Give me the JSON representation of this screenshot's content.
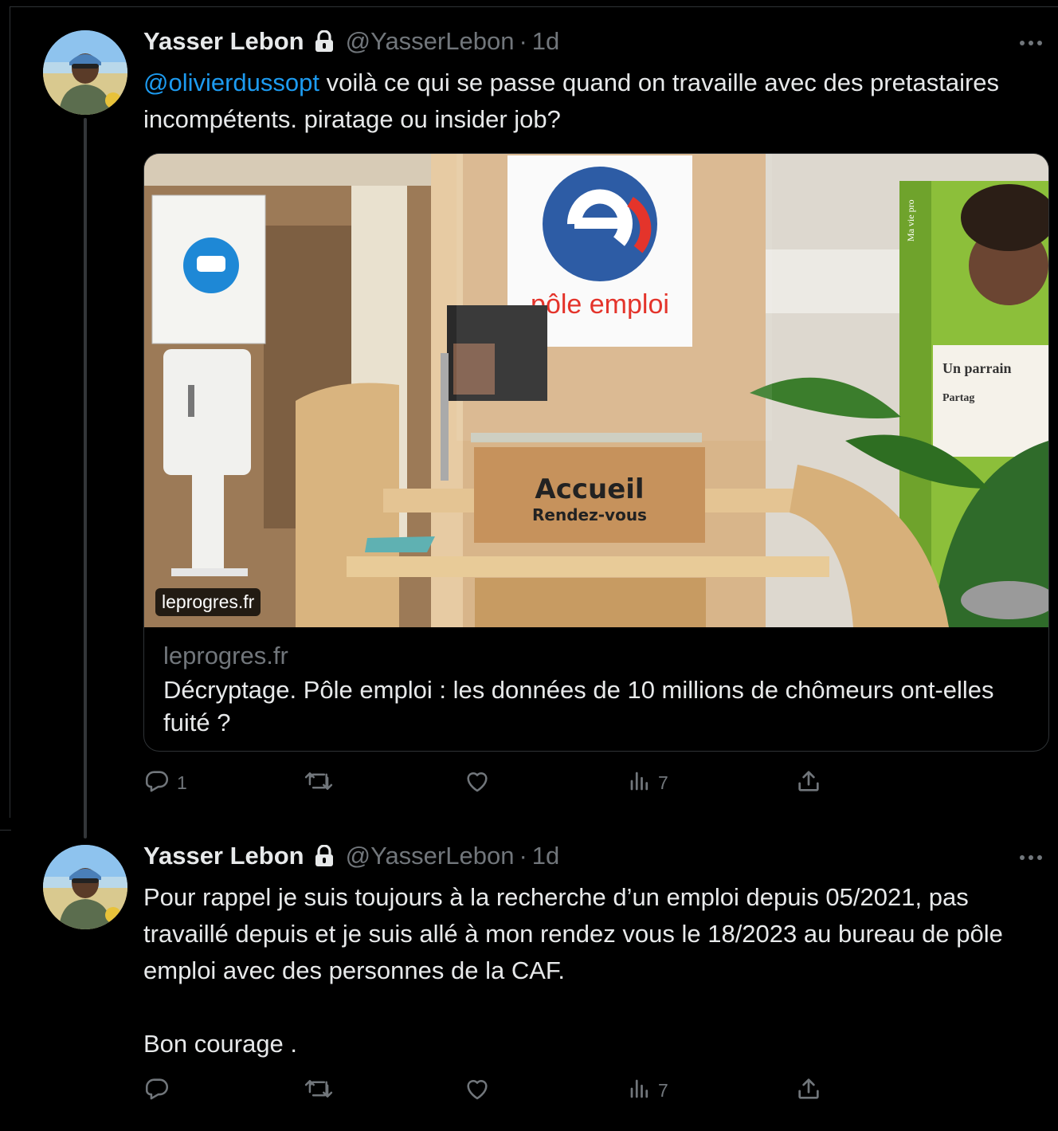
{
  "tweets": [
    {
      "author": {
        "name": "Yasser Lebon",
        "handle": "@YasserLebon",
        "time": "1d",
        "separator": "·"
      },
      "mention": "@olivierdussopt",
      "text": " voilà ce qui se passe quand on travaille avec des pretastaires incompétents. piratage ou insider job?",
      "card": {
        "badge": "leprogres.fr",
        "domain": "leprogres.fr",
        "title": "Décryptage. Pôle emploi : les données de 10 millions de chômeurs ont-elles fuité ?",
        "image_text": {
          "logo_caption": "pôle emploi",
          "sign_main": "Accueil",
          "sign_sub": "Rendez-vous",
          "poster_vertical": "Ma vie pro",
          "poster_line1": "Un parrain",
          "poster_line2": "Partag"
        }
      },
      "actions": {
        "reply_count": "1",
        "views_count": "7"
      }
    },
    {
      "author": {
        "name": "Yasser Lebon",
        "handle": "@YasserLebon",
        "time": "1d",
        "separator": "·"
      },
      "paragraphs": [
        "Pour rappel je suis toujours à la recherche d’un emploi depuis 05/2021, pas travaillé depuis et je suis allé à mon rendez vous le 18/2023 au bureau de pôle emploi avec des personnes de la CAF.",
        "Bon courage ."
      ],
      "actions": {
        "views_count": "7"
      }
    }
  ],
  "icons": [
    "lock-icon",
    "more-icon",
    "reply-icon",
    "retweet-icon",
    "like-icon",
    "views-icon",
    "share-icon"
  ],
  "colors": {
    "background": "#000000",
    "text": "#e7e9ea",
    "muted": "#71767b",
    "link": "#1d9bf0",
    "border": "#2f3336"
  }
}
